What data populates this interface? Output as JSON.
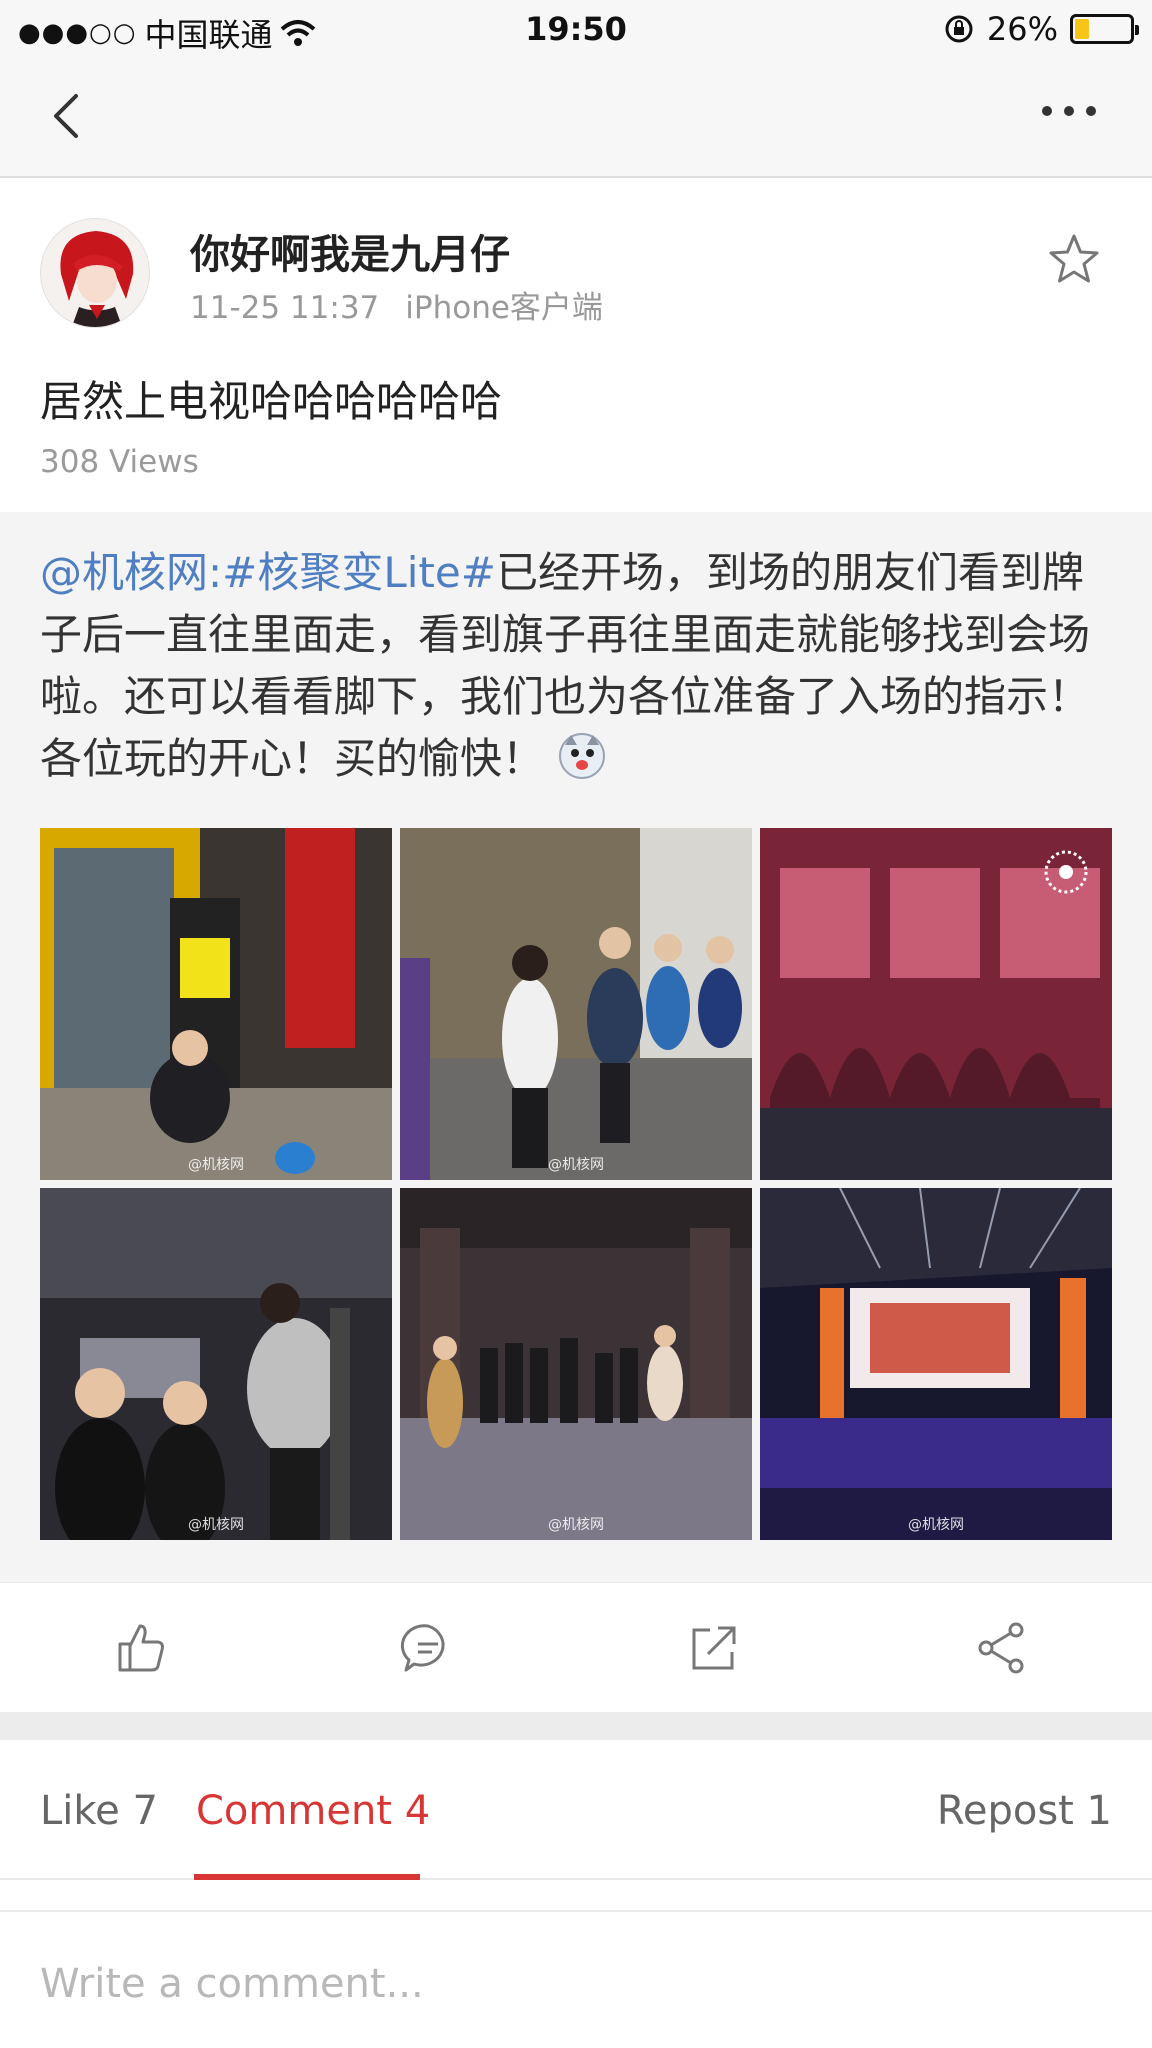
{
  "status_bar": {
    "signal_dots": "●●●○○",
    "carrier": "中国联通",
    "time": "19:50",
    "battery_percent_text": "26%",
    "battery_level": 0.26,
    "battery_color": "#f5c518"
  },
  "nav": {
    "back_icon": "chevron-left-icon",
    "more_icon": "more-horizontal-icon"
  },
  "post": {
    "username": "你好啊我是九月仔",
    "timestamp": "11-25 11:37",
    "source": "iPhone客户端",
    "text": "居然上电视哈哈哈哈哈哈",
    "views": "308 Views"
  },
  "repost": {
    "mention": "@机核网",
    "colon": ":",
    "hashtag": "#核聚变Lite#",
    "body": "已经开场，到场的朋友们看到牌子后一直往里面走，看到旗子再往里面走就能够找到会场啦。还可以看看脚下，我们也为各位准备了入场的指示！各位玩的开心！买的愉快！",
    "link_color": "#4f7fc2",
    "watermark": "@机核网"
  },
  "actions": {
    "like_icon": "thumbs-up-icon",
    "comment_icon": "comment-icon",
    "repost_icon": "repost-icon",
    "share_icon": "share-icon"
  },
  "tabs": {
    "like": "Like 7",
    "comment": "Comment 4",
    "repost": "Repost 1",
    "active_color": "#d83535"
  },
  "comment_box": {
    "placeholder": "Write a comment..."
  }
}
